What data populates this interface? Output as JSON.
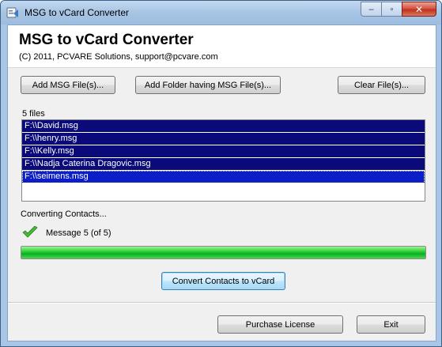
{
  "window": {
    "title": "MSG to vCard Converter",
    "caption": {
      "minimize": "‒",
      "maximize": "▫",
      "close": "✕"
    }
  },
  "header": {
    "title": "MSG to vCard Converter",
    "subtitle": "(C) 2011, PCVARE Solutions, support@pcvare.com"
  },
  "toolbar": {
    "add_files_label": "Add MSG File(s)...",
    "add_folder_label": "Add Folder having MSG File(s)...",
    "clear_files_label": "Clear File(s)..."
  },
  "files": {
    "count_label": "5 files",
    "items": [
      "F:\\\\David.msg",
      "F:\\\\henry.msg",
      "F:\\\\Kelly.msg",
      "F:\\\\Nadja Caterina Dragovic.msg",
      "F:\\\\seimens.msg"
    ]
  },
  "status": {
    "text": "Converting Contacts...",
    "message": "Message 5 (of 5)",
    "progress": 1.0
  },
  "actions": {
    "convert_label": "Convert Contacts to vCard",
    "purchase_label": "Purchase License",
    "exit_label": "Exit"
  },
  "colors": {
    "selection": "#0a0a7a",
    "focused_selection": "#0c1ec8",
    "progress": "#06b025"
  }
}
